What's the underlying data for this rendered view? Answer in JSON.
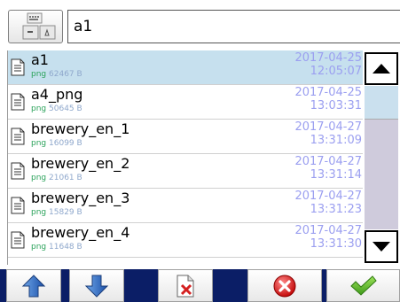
{
  "header": {
    "filename_value": "a1"
  },
  "files": [
    {
      "name": "a1",
      "ext": "png",
      "size": "62467 B",
      "date": "2017-04-25",
      "time": "12:05:07",
      "selected": true
    },
    {
      "name": "a4_png",
      "ext": "png",
      "size": "50645 B",
      "date": "2017-04-25",
      "time": "13:03:31",
      "selected": false
    },
    {
      "name": "brewery_en_1",
      "ext": "png",
      "size": "16099 B",
      "date": "2017-04-27",
      "time": "13:31:09",
      "selected": false
    },
    {
      "name": "brewery_en_2",
      "ext": "png",
      "size": "21061 B",
      "date": "2017-04-27",
      "time": "13:31:14",
      "selected": false
    },
    {
      "name": "brewery_en_3",
      "ext": "png",
      "size": "15829 B",
      "date": "2017-04-27",
      "time": "13:31:23",
      "selected": false
    },
    {
      "name": "brewery_en_4",
      "ext": "png",
      "size": "11648 B",
      "date": "2017-04-27",
      "time": "13:31:30",
      "selected": false
    }
  ],
  "colors": {
    "selected_row": "#c6e0ee",
    "date_text": "#9b9ff0",
    "ext_text": "#2aa25a",
    "size_text": "#8fa8cc",
    "toolbar_separator": "#0b1e66"
  },
  "icons": {
    "keyboard": "keyboard-icon",
    "file": "document-icon",
    "scroll_up": "triangle-up-icon",
    "scroll_down": "triangle-down-icon",
    "move_up": "arrow-up-icon",
    "move_down": "arrow-down-icon",
    "delete_file": "delete-file-icon",
    "cancel": "cancel-icon",
    "confirm": "checkmark-icon"
  },
  "scroll_position": 0
}
